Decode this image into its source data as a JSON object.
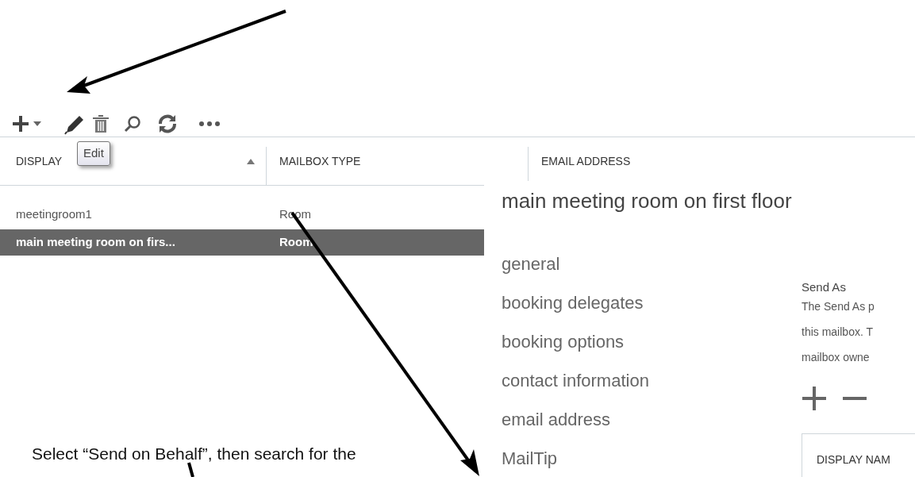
{
  "toolbar": {
    "tooltip": "Edit"
  },
  "table": {
    "columns": [
      {
        "label": "DISPLAY",
        "sorted": true
      },
      {
        "label": "MAILBOX TYPE",
        "sorted": false
      },
      {
        "label": "EMAIL ADDRESS",
        "sorted": false
      }
    ],
    "rows": [
      {
        "cells": [
          "meetingroom1",
          "Room"
        ],
        "selected": false
      },
      {
        "cells": [
          "main meeting room on firs...",
          "Room"
        ],
        "selected": true
      }
    ]
  },
  "dialog": {
    "title": "main meeting room on first floor",
    "nav": [
      "general",
      "booking delegates",
      "booking options",
      "contact information",
      "email address",
      "MailTip"
    ],
    "section_title": "Send As",
    "description_lines": [
      "The Send As p",
      "this mailbox. T",
      "mailbox owne"
    ],
    "list_column": "DISPLAY NAM"
  },
  "caption": "Select “Send on Behalf”, then search for the"
}
